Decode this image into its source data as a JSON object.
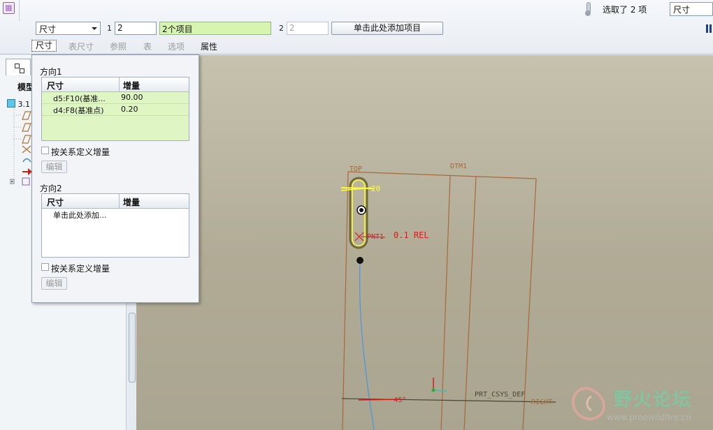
{
  "toolbar": {
    "status": "选取了 2 项",
    "type_dropdown": "尺寸",
    "type_combo": "尺寸",
    "dir1_index": "1",
    "dir1_value": "2",
    "dir1_items": "2个项目",
    "dir2_index": "2",
    "dir2_value": "2",
    "add_item_button": "单击此处添加项目"
  },
  "tabs": {
    "dimension": "尺寸",
    "table_dimension": "表尺寸",
    "reference": "参照",
    "table": "表",
    "options": "选项",
    "properties": "属性"
  },
  "tree": {
    "heading": "模型",
    "root": "3.1"
  },
  "popup": {
    "direction1_label": "方向1",
    "direction2_label": "方向2",
    "col_dimension": "尺寸",
    "col_increment": "增量",
    "rows1": [
      {
        "dim": "d5:F10(基准...",
        "inc": "90.00"
      },
      {
        "dim": "d4:F8(基准点)",
        "inc": "0.20"
      }
    ],
    "rows2_placeholder": "单击此处添加...",
    "checkbox_label": "按关系定义增量",
    "edit_button": "编辑"
  },
  "scene": {
    "top_label": "TOP",
    "dtm_label": "DTM1",
    "dim_label": "20",
    "pnt_label": "PNT1",
    "rel_label": "0.1 REL",
    "csys_label": "PRT_CSYS_DEF",
    "right_label": "RIGHT",
    "angle_label": "45°"
  },
  "watermark": {
    "title": "野火论坛",
    "url": "www.proewildfire.cn"
  },
  "colors": {
    "datum": "#a8683a",
    "curve": "#4f97d8",
    "highlight": "#ffff33",
    "annotation": "#d81c1c"
  }
}
